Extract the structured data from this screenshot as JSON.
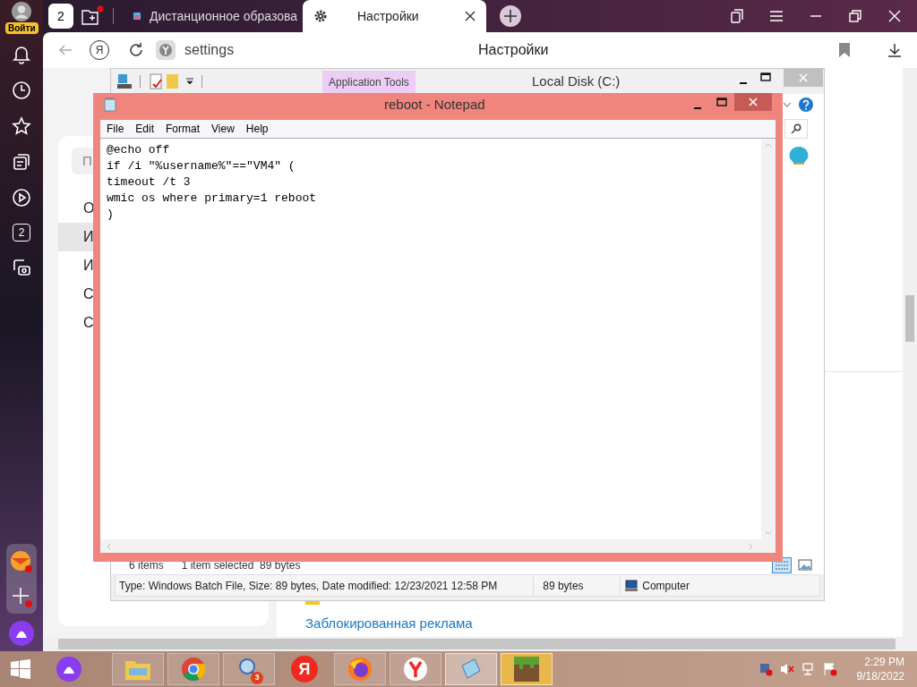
{
  "browser": {
    "profile_label": "Войти",
    "tab_group_count": "2",
    "tabs": [
      {
        "title": "Дистанционное образова",
        "selected": false
      },
      {
        "title": "Настройки",
        "selected": true
      }
    ],
    "yandex_button": "Я",
    "address": "settings",
    "page_title": "Настройки"
  },
  "sidebar": {
    "counter": "2"
  },
  "settings_page": {
    "search_placeholder": "П",
    "menu": [
      {
        "label": "О",
        "selected": false
      },
      {
        "label": "И",
        "selected": true
      },
      {
        "label": "И",
        "selected": false
      },
      {
        "label": "С",
        "selected": false
      },
      {
        "label": "С",
        "selected": false
      }
    ],
    "link": "Заблокированная реклама"
  },
  "explorer": {
    "title": "Local Disk (C:)",
    "context_tab": "Application Tools",
    "item_count": "6 items",
    "selection": "1 item selected  89 bytes",
    "details": "Type: Windows Batch File, Size: 89 bytes, Date modified: 12/23/2021 12:58 PM",
    "size": "89 bytes",
    "location": "Computer"
  },
  "notepad": {
    "title": "reboot - Notepad",
    "menu": [
      "File",
      "Edit",
      "Format",
      "View",
      "Help"
    ],
    "lines": [
      "@echo off",
      "if /i \"%username%\"==\"VM4\" (",
      "timeout /t 3",
      "wmic os where primary=1 reboot",
      ")"
    ]
  },
  "taskbar": {
    "yandex_letter": "Я",
    "badge": "3",
    "time": "2:29 PM",
    "date": "9/18/2022"
  }
}
